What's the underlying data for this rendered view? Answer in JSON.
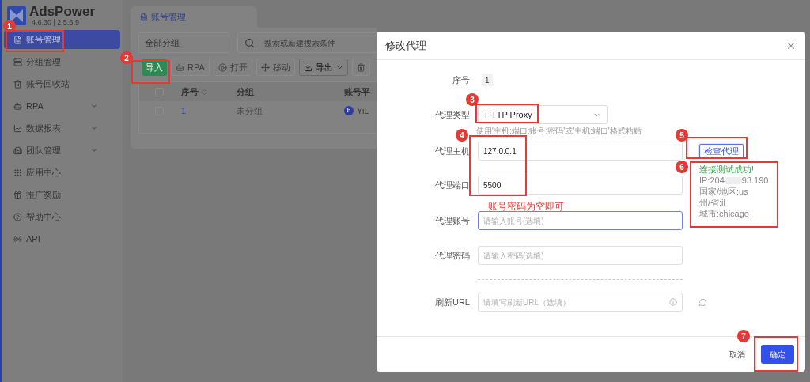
{
  "app": {
    "name": "AdsPower",
    "version": "4.6.30 | 2.5.6.9"
  },
  "sidebar": {
    "items": [
      {
        "label": "账号管理",
        "kind": "link",
        "selected": true
      },
      {
        "label": "分组管理",
        "kind": "link",
        "selected": false
      },
      {
        "label": "账号回收站",
        "kind": "link",
        "selected": false
      },
      {
        "label": "RPA",
        "kind": "group",
        "selected": false
      },
      {
        "label": "数据报表",
        "kind": "group",
        "selected": false
      },
      {
        "label": "团队管理",
        "kind": "group",
        "selected": false
      },
      {
        "label": "应用中心",
        "kind": "link",
        "selected": false
      },
      {
        "label": "推广奖励",
        "kind": "link",
        "selected": false
      },
      {
        "label": "帮助中心",
        "kind": "link",
        "selected": false
      },
      {
        "label": "API",
        "kind": "link",
        "selected": false
      }
    ]
  },
  "main": {
    "tab": "账号管理",
    "group_filter": "全部分组",
    "search": {
      "placeholder": "搜索或新建搜索条件"
    },
    "toolbar": [
      {
        "label": "导入",
        "kind": "primary",
        "disabled": false
      },
      {
        "label": "RPA",
        "kind": "rpa",
        "disabled": true
      },
      {
        "label": "打开",
        "kind": "open",
        "disabled": true
      },
      {
        "label": "移动",
        "kind": "move",
        "disabled": true
      },
      {
        "label": "导出",
        "kind": "export",
        "disabled": false
      },
      {
        "kind": "trash",
        "disabled": true
      }
    ],
    "table": {
      "header_checked": false,
      "columns": [
        "序号",
        "分组",
        "账号平"
      ],
      "rows": [
        {
          "checked": false,
          "cells": [
            "1",
            "未分组",
            "YiL"
          ],
          "platform_icon": "b"
        }
      ]
    }
  },
  "dialog": {
    "title": "修改代理",
    "fields": [
      {
        "kind": "badge",
        "label": "序号",
        "value": "1"
      },
      {
        "kind": "select",
        "label": "代理类型",
        "value": "HTTP Proxy"
      },
      {
        "kind": "hint",
        "text": "使用'主机:端口:账号:密码'或'主机:端口'格式粘贴"
      },
      {
        "kind": "input",
        "label": "代理主机",
        "value": "127.0.0.1",
        "focused": false,
        "button": "检查代理"
      },
      {
        "kind": "input",
        "label": "代理端口",
        "value": "5500",
        "focused": false,
        "result": {
          "status": "连接测试成功!",
          "ip_start": "IP:204",
          "ip_end": "93.190",
          "lines": [
            "国家/地区:us",
            "州/省:il",
            "城市:chicago"
          ]
        }
      },
      {
        "kind": "note",
        "text": "账号密码为空即可"
      },
      {
        "kind": "input",
        "label": "代理账号",
        "placeholder": "请输入账号(选填)",
        "focused": true
      },
      {
        "kind": "input",
        "label": "代理密码",
        "placeholder": "请输入密码(选填)",
        "focused": false
      },
      {
        "kind": "divider"
      },
      {
        "kind": "url",
        "label": "刷新URL",
        "placeholder": "请填写刷新URL（选填）"
      }
    ],
    "cancel": "取消",
    "confirm": "确定"
  },
  "annotations": [
    {
      "number": "1"
    },
    {
      "number": "2"
    },
    {
      "number": "3"
    },
    {
      "number": "4"
    },
    {
      "number": "5"
    },
    {
      "number": "6"
    },
    {
      "number": "7"
    }
  ]
}
